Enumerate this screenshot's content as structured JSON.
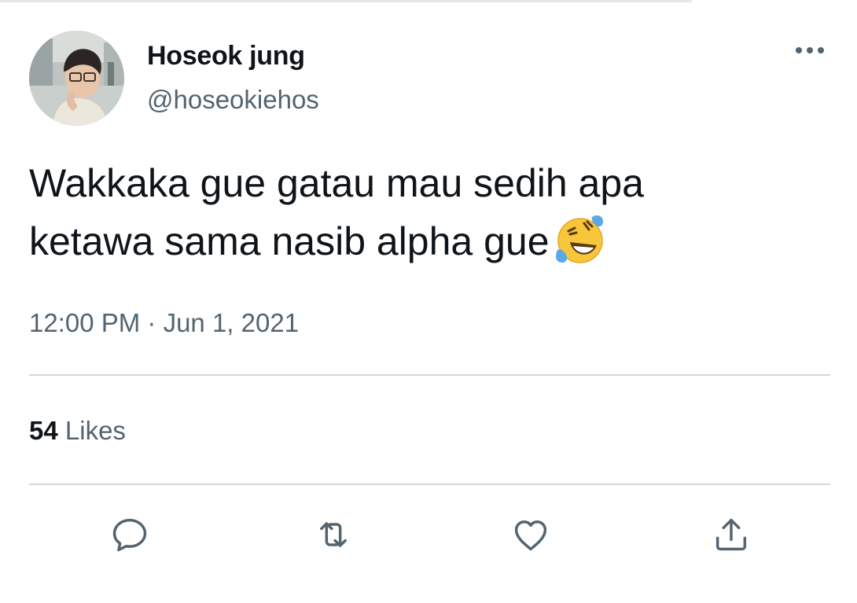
{
  "tweet": {
    "author_name": "Hoseok jung",
    "author_handle": "@hoseokiehos",
    "text_line1": "Wakkaka gue gatau mau sedih apa",
    "text_line2": "ketawa sama nasib alpha gue",
    "emoji": "rolling-on-the-floor-laughing",
    "timestamp": "12:00 PM · Jun 1, 2021",
    "likes_count": "54",
    "likes_label": "Likes"
  },
  "actions": [
    {
      "icon": "reply-icon"
    },
    {
      "icon": "retweet-icon"
    },
    {
      "icon": "like-icon"
    },
    {
      "icon": "share-icon"
    }
  ],
  "colors": {
    "text_primary": "#0f1419",
    "text_secondary": "#536471",
    "divider": "#cfd9de",
    "background": "#ffffff"
  }
}
